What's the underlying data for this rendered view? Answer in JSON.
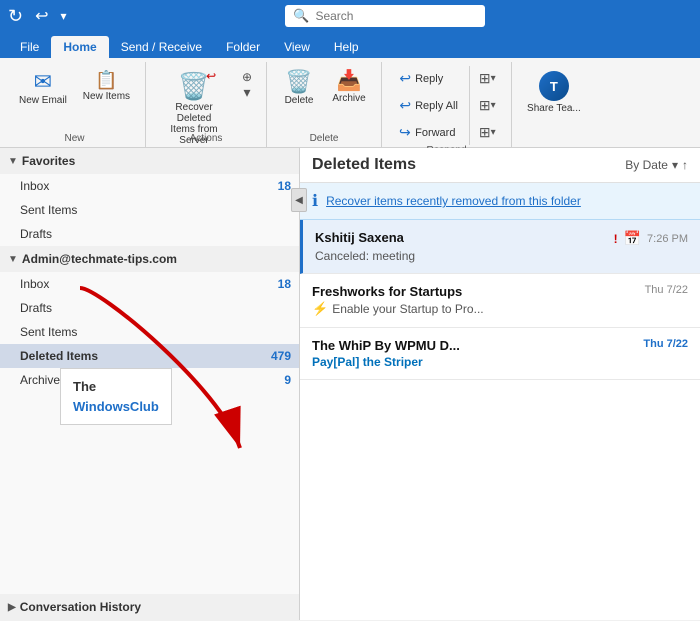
{
  "titlebar": {
    "refresh_icon": "↻",
    "undo_icon": "↩",
    "search_placeholder": "Search"
  },
  "ribbon_tabs": [
    {
      "id": "file",
      "label": "File"
    },
    {
      "id": "home",
      "label": "Home",
      "active": true
    },
    {
      "id": "send_receive",
      "label": "Send / Receive"
    },
    {
      "id": "folder",
      "label": "Folder"
    },
    {
      "id": "view",
      "label": "View"
    },
    {
      "id": "help",
      "label": "Help"
    }
  ],
  "ribbon": {
    "groups": {
      "new": {
        "label": "New",
        "new_email_label": "New\nEmail",
        "new_items_label": "New\nItems"
      },
      "actions": {
        "label": "Actions",
        "recover_label": "Recover Deleted\nItems from Server"
      },
      "delete": {
        "label": "Delete",
        "delete_label": "Delete",
        "archive_label": "Archive"
      },
      "respond": {
        "label": "Respond",
        "reply_label": "Reply",
        "reply_all_label": "Reply All",
        "forward_label": "Forward"
      },
      "teams": {
        "label": "Share Tea...",
        "avatar_initials": "T"
      }
    }
  },
  "sidebar": {
    "favorites_label": "Favorites",
    "items_favorites": [
      {
        "label": "Inbox",
        "badge": "18"
      },
      {
        "label": "Sent Items",
        "badge": ""
      },
      {
        "label": "Drafts",
        "badge": ""
      }
    ],
    "account_label": "Admin@techmate-tips.com",
    "items_account": [
      {
        "label": "Inbox",
        "badge": "18"
      },
      {
        "label": "Drafts",
        "badge": ""
      },
      {
        "label": "Sent Items",
        "badge": ""
      },
      {
        "label": "Deleted Items",
        "badge": "479",
        "selected": true
      },
      {
        "label": "Archive",
        "badge": "9"
      }
    ],
    "conversation_history_label": "Conversation History"
  },
  "watermark": {
    "line1": "The",
    "line2": "WindowsClub"
  },
  "content": {
    "title": "Deleted Items",
    "sort_label": "By Date",
    "sort_icon": "▾",
    "sort_arrow": "↑",
    "recover_banner": "Recover items recently removed from this folder",
    "emails": [
      {
        "sender": "Kshitij Saxena",
        "subject": "Canceled: meeting",
        "time": "7:26 PM",
        "priority": true,
        "calendar_icon": true,
        "selected": true
      },
      {
        "sender": "Freshworks for Startups",
        "subject": "Enable your Startup to Pro...",
        "time": "Thu 7/22",
        "lightning": true
      },
      {
        "sender": "The WhiP By WPMU D...",
        "subject": "Pay[Pal] the Striper",
        "time": "Thu 7/22",
        "paypal": true
      }
    ]
  },
  "statusbar": {
    "label": "Conversation History"
  }
}
